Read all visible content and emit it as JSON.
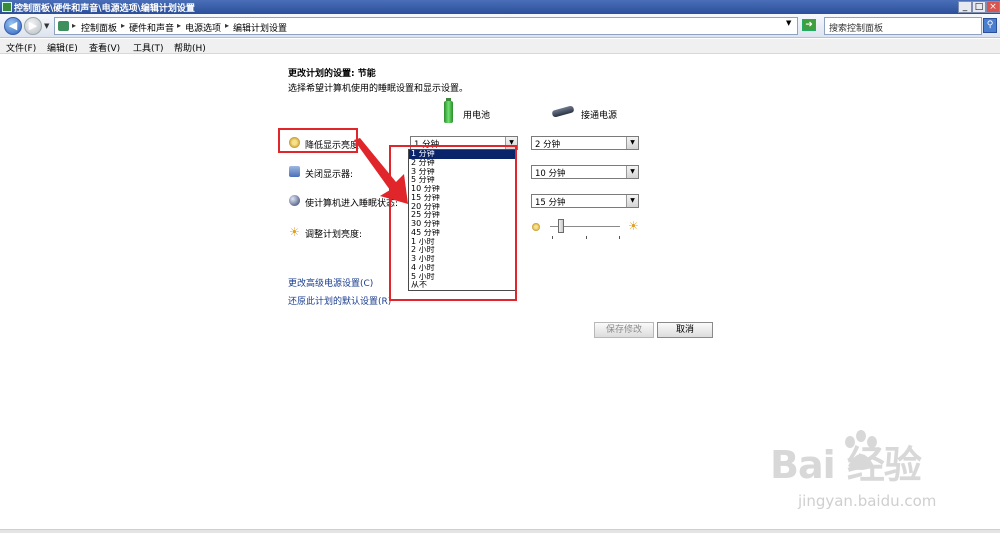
{
  "window": {
    "title": "控制面板\\硬件和声音\\电源选项\\编辑计划设置",
    "controls": [
      "_",
      "□",
      "×"
    ]
  },
  "address": {
    "crumbs": [
      "控制面板",
      "硬件和声音",
      "电源选项",
      "编辑计划设置"
    ],
    "search_placeholder": "搜索控制面板"
  },
  "menu": [
    "文件(F)",
    "编辑(E)",
    "查看(V)",
    "工具(T)",
    "帮助(H)"
  ],
  "content": {
    "heading": "更改计划的设置: 节能",
    "subtitle": "选择希望计算机使用的睡眠设置和显示设置。",
    "col_battery": "用电池",
    "col_plugged": "接通电源",
    "rows": {
      "dim": {
        "label": "降低显示亮度:",
        "battery": "1 分钟",
        "plugged": "2 分钟"
      },
      "display": {
        "label": "关闭显示器:",
        "plugged": "10 分钟"
      },
      "sleep": {
        "label": "使计算机进入睡眠状态:",
        "plugged": "15 分钟"
      },
      "brightness": {
        "label": "调整计划亮度:",
        "level_fraction": 0.15
      }
    },
    "dropdown_options": [
      "1 分钟",
      "2 分钟",
      "3 分钟",
      "5 分钟",
      "10 分钟",
      "15 分钟",
      "20 分钟",
      "25 分钟",
      "30 分钟",
      "45 分钟",
      "1 小时",
      "2 小时",
      "3 小时",
      "4 小时",
      "5 小时",
      "从不"
    ],
    "dropdown_selected_index": 0,
    "link_advanced": "更改高级电源设置(C)",
    "link_restore": "还原此计划的默认设置(R)",
    "save_label": "保存修改",
    "cancel_label": "取消"
  },
  "watermark": {
    "logo": "Bai  经验",
    "url": "jingyan.baidu.com"
  },
  "colors": {
    "annotation": "#e0262a",
    "selection": "#0a246a",
    "link": "#1a3e8f"
  }
}
